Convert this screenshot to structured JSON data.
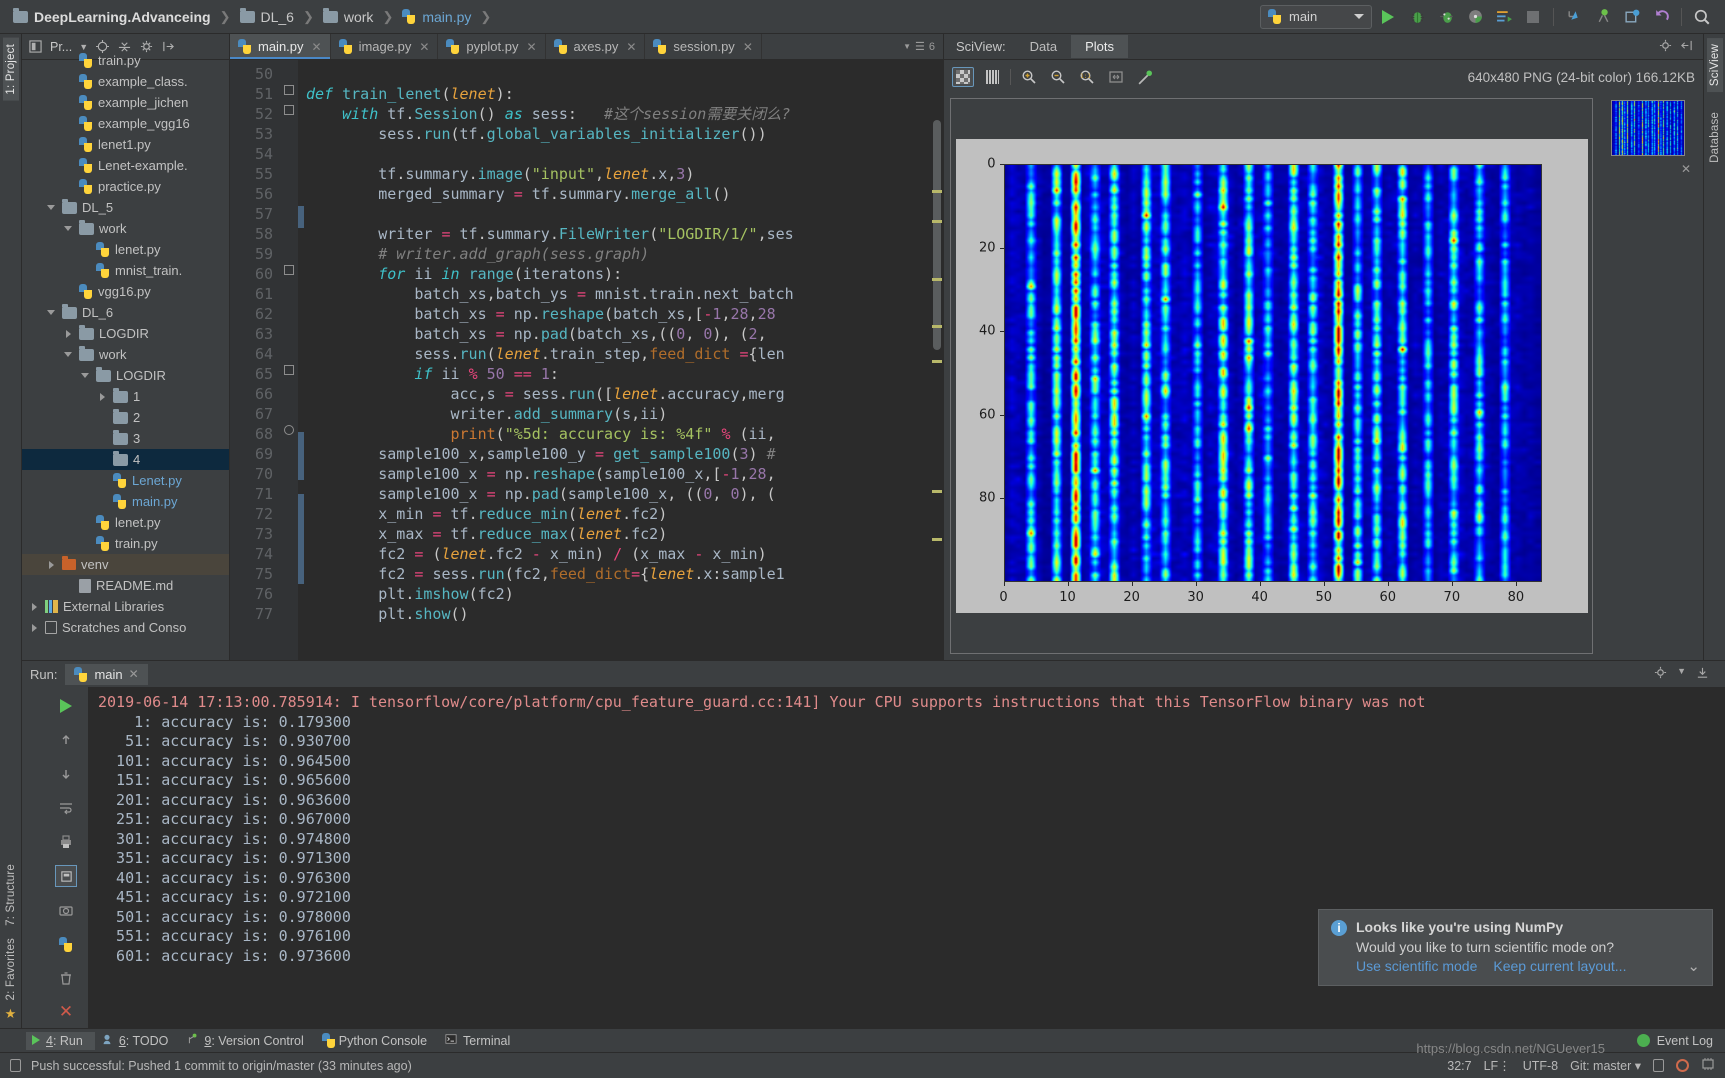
{
  "window": {
    "breadcrumbs": [
      {
        "label": "DeepLearning.Advanceing",
        "icon": "folder-icon",
        "style": "bold"
      },
      {
        "label": "DL_6",
        "icon": "folder-icon",
        "style": "normal"
      },
      {
        "label": "work",
        "icon": "folder-icon",
        "style": "normal"
      },
      {
        "label": "main.py",
        "icon": "python-file-icon",
        "style": "blue"
      }
    ]
  },
  "toolbar": {
    "run_config": "main",
    "run_config_icon": "python-icon",
    "buttons": [
      {
        "name": "run-button",
        "icon": "play-icon"
      },
      {
        "name": "debug-button",
        "icon": "bug-icon"
      },
      {
        "name": "run-coverage-button",
        "icon": "coverage-icon"
      },
      {
        "name": "profile-button",
        "icon": "profile-icon"
      },
      {
        "name": "run-with-console-button",
        "icon": "console-run-icon"
      },
      {
        "name": "stop-button",
        "icon": "stop-icon"
      },
      {
        "name": "update-project-button",
        "icon": "vcs-update-icon"
      },
      {
        "name": "commit-button",
        "icon": "vcs-commit-icon"
      },
      {
        "name": "history-button",
        "icon": "vcs-history-icon"
      },
      {
        "name": "rollback-button",
        "icon": "vcs-rollback-icon"
      },
      {
        "name": "search-everywhere-button",
        "icon": "search-icon"
      }
    ]
  },
  "left_rail": {
    "tabs": [
      "1: Project",
      "7: Structure",
      "2: Favorites"
    ]
  },
  "project": {
    "title": "Pr...",
    "header_icons": [
      "project-view-icon",
      "target-icon",
      "collapse-icon",
      "gear-icon",
      "hide-icon"
    ],
    "tree": [
      {
        "label": "train.py",
        "indent": 2,
        "type": "py",
        "twisty": "",
        "partial": true
      },
      {
        "label": "example_class.",
        "indent": 2,
        "type": "py",
        "twisty": ""
      },
      {
        "label": "example_jichen",
        "indent": 2,
        "type": "py",
        "twisty": ""
      },
      {
        "label": "example_vgg16",
        "indent": 2,
        "type": "py",
        "twisty": ""
      },
      {
        "label": "lenet1.py",
        "indent": 2,
        "type": "py",
        "twisty": ""
      },
      {
        "label": "Lenet-example.",
        "indent": 2,
        "type": "py",
        "twisty": ""
      },
      {
        "label": "practice.py",
        "indent": 2,
        "type": "py",
        "twisty": ""
      },
      {
        "label": "DL_5",
        "indent": 1,
        "type": "folder",
        "twisty": "down"
      },
      {
        "label": "work",
        "indent": 2,
        "type": "folder",
        "twisty": "down"
      },
      {
        "label": "lenet.py",
        "indent": 3,
        "type": "py",
        "twisty": ""
      },
      {
        "label": "mnist_train.",
        "indent": 3,
        "type": "py",
        "twisty": ""
      },
      {
        "label": "vgg16.py",
        "indent": 2,
        "type": "py",
        "twisty": ""
      },
      {
        "label": "DL_6",
        "indent": 1,
        "type": "folder",
        "twisty": "down"
      },
      {
        "label": "LOGDIR",
        "indent": 2,
        "type": "folder",
        "twisty": "right"
      },
      {
        "label": "work",
        "indent": 2,
        "type": "folder",
        "twisty": "down"
      },
      {
        "label": "LOGDIR",
        "indent": 3,
        "type": "folder",
        "twisty": "down"
      },
      {
        "label": "1",
        "indent": 4,
        "type": "folder",
        "twisty": "right"
      },
      {
        "label": "2",
        "indent": 4,
        "type": "folder",
        "twisty": ""
      },
      {
        "label": "3",
        "indent": 4,
        "type": "folder",
        "twisty": ""
      },
      {
        "label": "4",
        "indent": 4,
        "type": "folder",
        "twisty": "",
        "selected": true
      },
      {
        "label": "Lenet.py",
        "indent": 4,
        "type": "py",
        "twisty": "",
        "blue": true
      },
      {
        "label": "main.py",
        "indent": 4,
        "type": "py",
        "twisty": "",
        "blue": true
      },
      {
        "label": "lenet.py",
        "indent": 3,
        "type": "py",
        "twisty": ""
      },
      {
        "label": "train.py",
        "indent": 3,
        "type": "py",
        "twisty": ""
      },
      {
        "label": "venv",
        "indent": 1,
        "type": "folder-orange",
        "twisty": "right",
        "venv": true
      },
      {
        "label": "README.md",
        "indent": 2,
        "type": "md",
        "twisty": ""
      },
      {
        "label": "External Libraries",
        "indent": 0,
        "type": "lib",
        "twisty": "right"
      },
      {
        "label": "Scratches and Conso",
        "indent": 0,
        "type": "scratch",
        "twisty": "right"
      }
    ]
  },
  "editor": {
    "tabs": [
      {
        "label": "main.py",
        "active": true
      },
      {
        "label": "image.py",
        "active": false
      },
      {
        "label": "pyplot.py",
        "active": false
      },
      {
        "label": "axes.py",
        "active": false
      },
      {
        "label": "session.py",
        "active": false
      }
    ],
    "tabs_right_badge": "6",
    "first_line_number": 50,
    "lines": [
      {
        "n": 50,
        "text": ""
      },
      {
        "n": 51,
        "text": "def train_lenet(lenet):"
      },
      {
        "n": 52,
        "text": "    with tf.Session() as sess:   #这个session需要关闭么?"
      },
      {
        "n": 53,
        "text": "        sess.run(tf.global_variables_initializer())"
      },
      {
        "n": 54,
        "text": ""
      },
      {
        "n": 55,
        "text": "        tf.summary.image(\"input\",lenet.x,3)"
      },
      {
        "n": 56,
        "text": "        merged_summary = tf.summary.merge_all()"
      },
      {
        "n": 57,
        "text": ""
      },
      {
        "n": 58,
        "text": "        writer = tf.summary.FileWriter(\"LOGDIR/1/\",ses"
      },
      {
        "n": 59,
        "text": "        # writer.add_graph(sess.graph)"
      },
      {
        "n": 60,
        "text": "        for ii in range(iteratons):"
      },
      {
        "n": 61,
        "text": "            batch_xs,batch_ys = mnist.train.next_batch"
      },
      {
        "n": 62,
        "text": "            batch_xs = np.reshape(batch_xs,[-1,28,28"
      },
      {
        "n": 63,
        "text": "            batch_xs = np.pad(batch_xs,((0, 0), (2, "
      },
      {
        "n": 64,
        "text": "            sess.run(lenet.train_step,feed_dict ={len"
      },
      {
        "n": 65,
        "text": "            if ii % 50 == 1:"
      },
      {
        "n": 66,
        "text": "                acc,s = sess.run([lenet.accuracy,merg"
      },
      {
        "n": 67,
        "text": "                writer.add_summary(s,ii)"
      },
      {
        "n": 68,
        "text": "                print(\"%5d: accuracy is: %4f\" % (ii,"
      },
      {
        "n": 69,
        "text": "        sample100_x,sample100_y = get_sample100(3) #"
      },
      {
        "n": 70,
        "text": "        sample100_x = np.reshape(sample100_x,[-1,28,"
      },
      {
        "n": 71,
        "text": "        sample100_x = np.pad(sample100_x, ((0, 0), ("
      },
      {
        "n": 72,
        "text": "        x_min = tf.reduce_min(lenet.fc2)"
      },
      {
        "n": 73,
        "text": "        x_max = tf.reduce_max(lenet.fc2)"
      },
      {
        "n": 74,
        "text": "        fc2 = (lenet.fc2 - x_min) / (x_max - x_min)"
      },
      {
        "n": 75,
        "text": "        fc2 = sess.run(fc2,feed_dict={lenet.x:sample1"
      },
      {
        "n": 76,
        "text": "        plt.imshow(fc2)"
      },
      {
        "n": 77,
        "text": "        plt.show()"
      }
    ]
  },
  "sciview": {
    "label": "SciView:",
    "tabs": [
      {
        "label": "Data",
        "active": false
      },
      {
        "label": "Plots",
        "active": true
      }
    ],
    "tools": [
      {
        "name": "transparency-toggle",
        "icon": "checker-icon",
        "selected": true
      },
      {
        "name": "grid-toggle",
        "icon": "grid-icon",
        "selected": false
      },
      {
        "name": "zoom-in-button",
        "icon": "zoom-in-icon"
      },
      {
        "name": "zoom-out-button",
        "icon": "zoom-out-icon"
      },
      {
        "name": "zoom-actual-button",
        "icon": "zoom-1to1-icon"
      },
      {
        "name": "fit-button",
        "icon": "fit-icon"
      },
      {
        "name": "color-picker-button",
        "icon": "eyedropper-icon"
      }
    ],
    "image_info": "640x480 PNG (24-bit color) 166.12KB"
  },
  "chart_data": {
    "type": "heatmap",
    "title": "",
    "xlabel": "",
    "ylabel": "",
    "colormap": "jet",
    "xlim": [
      0,
      84
    ],
    "ylim": [
      0,
      100
    ],
    "y_ticks": [
      0,
      20,
      40,
      60,
      80
    ],
    "x_ticks": [
      0,
      10,
      20,
      30,
      40,
      50,
      60,
      70,
      80
    ],
    "x_ticklabels": [
      "0",
      "10",
      "20",
      "30",
      "40",
      "50",
      "60",
      "70",
      "80"
    ],
    "y_ticklabels": [
      "0",
      "20",
      "40",
      "60",
      "80"
    ],
    "grid": false,
    "legend": "none",
    "description": "100x84 activation matrix of LeNet fc2 layer, normalized 0-1, rendered with jet colormap; mostly dark blue background with vertical bright stripes",
    "bright_columns": [
      4,
      8,
      11,
      14,
      17,
      22,
      25,
      30,
      34,
      38,
      41,
      45,
      48,
      52,
      55,
      58,
      62,
      66,
      70,
      74,
      78
    ],
    "hot_columns": [
      11,
      52
    ],
    "value_range": [
      0,
      1
    ]
  },
  "run_panel": {
    "label": "Run:",
    "tab": "main",
    "side_icons": [
      "rerun-icon",
      "scroll-up-icon",
      "scroll-down-icon",
      "soft-wrap-icon",
      "print-icon",
      "pin-icon",
      "close-icon",
      "settings-icon",
      "camera-icon",
      "trash-icon"
    ],
    "console_lines": [
      {
        "text": "2019-06-14 17:13:00.785914: I tensorflow/core/platform/cpu_feature_guard.cc:141] Your CPU supports instructions that this TensorFlow binary was not",
        "warn": true
      },
      {
        "text": "    1: accuracy is: 0.179300",
        "warn": false
      },
      {
        "text": "   51: accuracy is: 0.930700",
        "warn": false
      },
      {
        "text": "  101: accuracy is: 0.964500",
        "warn": false
      },
      {
        "text": "  151: accuracy is: 0.965600",
        "warn": false
      },
      {
        "text": "  201: accuracy is: 0.963600",
        "warn": false
      },
      {
        "text": "  251: accuracy is: 0.967000",
        "warn": false
      },
      {
        "text": "  301: accuracy is: 0.974800",
        "warn": false
      },
      {
        "text": "  351: accuracy is: 0.971300",
        "warn": false
      },
      {
        "text": "  401: accuracy is: 0.976300",
        "warn": false
      },
      {
        "text": "  451: accuracy is: 0.972100",
        "warn": false
      },
      {
        "text": "  501: accuracy is: 0.978000",
        "warn": false
      },
      {
        "text": "  551: accuracy is: 0.976100",
        "warn": false
      },
      {
        "text": "  601: accuracy is: 0.973600",
        "warn": false
      }
    ]
  },
  "notification": {
    "title": "Looks like you're using NumPy",
    "message": "Would you like to turn scientific mode on?",
    "action_primary": "Use scientific mode",
    "action_secondary": "Keep current layout...",
    "icon": "info-icon",
    "expand_icon": "chevron-down-icon"
  },
  "tool_window_bar": {
    "items": [
      {
        "num": "4",
        "label": "Run",
        "icon": "play-icon",
        "selected": true
      },
      {
        "num": "6",
        "label": "TODO",
        "icon": "todo-icon",
        "selected": false
      },
      {
        "num": "9",
        "label": "Version Control",
        "icon": "vcs-icon",
        "selected": false
      },
      {
        "num": "",
        "label": "Python Console",
        "icon": "python-icon",
        "selected": false
      },
      {
        "num": "",
        "label": "Terminal",
        "icon": "terminal-icon",
        "selected": false
      }
    ],
    "event_log": "Event Log"
  },
  "status_bar": {
    "message": "Push successful: Pushed 1 commit to origin/master (33 minutes ago)",
    "caret": "32:7",
    "line_sep": "LF",
    "encoding": "UTF-8",
    "branch": "Git: master",
    "watermark": "https://blog.csdn.net/NGUever15"
  },
  "right_rail": {
    "tabs": [
      "SciView",
      "Database"
    ]
  },
  "colors": {
    "bg": "#3c3f41",
    "editor_bg": "#2b2b2b",
    "accent_blue": "#4a88c7",
    "link_blue": "#5b9ad6",
    "selection": "#0d293e",
    "green_run": "#5ac45a",
    "warn_red": "#e08b8b"
  }
}
